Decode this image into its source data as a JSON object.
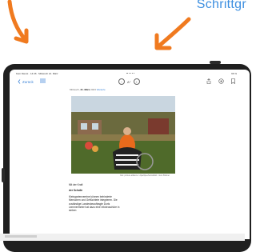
{
  "heading": {
    "text": "Schrittgr"
  },
  "status_bar": {
    "left_text": "Kein Dienst · 14:46 · Mittwoch 21. März",
    "right_text": "96 %"
  },
  "toolbar": {
    "back_label": "Zurück",
    "text_size_label": "A⁺"
  },
  "article": {
    "date_prefix": "Mittwoch,",
    "date_strong": "21. März",
    "date_suffix": "2023",
    "date_link": "Weiterle",
    "caption": "foto: picture-alliance / dpa/dpa-Zentralbild / Jens Büttner",
    "lines": [
      "Mit der Kraft",
      "der Scholle"
    ],
    "body": "Kleingartenvereine können behinderte Menschen und Geflüchtete integrieren. Die zuständige Landesbeauftragte Doris Lemmermeier hat dazu eine Infobroschüre in sieben"
  },
  "colors": {
    "accent": "#3d8fe0",
    "arrow": "#f07a1f",
    "bezel": "#1f1f1f"
  },
  "icons": [
    "arrow-annotation-icon",
    "chevron-left-icon",
    "list-icon",
    "minus-circle-icon",
    "plus-circle-icon",
    "share-icon",
    "settings-icon",
    "bookmark-icon"
  ]
}
